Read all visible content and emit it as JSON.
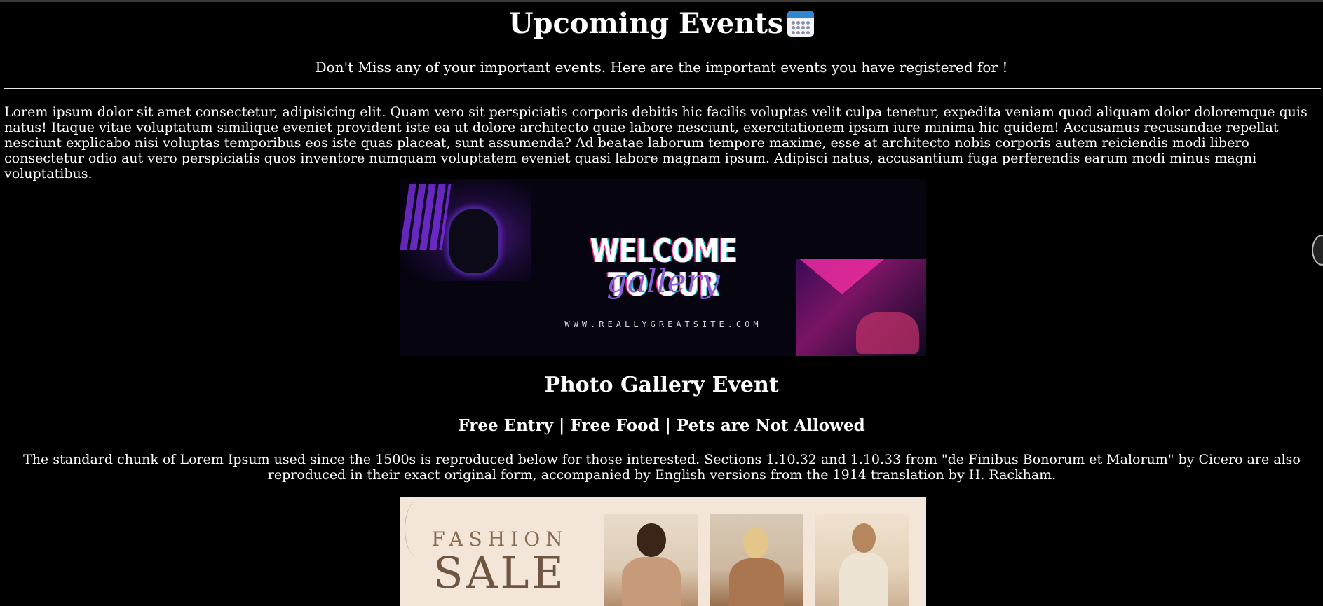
{
  "header": {
    "title": "Upcoming Events",
    "title_icon": "calendar-icon",
    "subtitle": "Don't Miss any of your important events. Here are the important events you have registered for !"
  },
  "intro": {
    "text": "Lorem ipsum dolor sit amet consectetur, adipisicing elit. Quam vero sit perspiciatis corporis debitis hic facilis voluptas velit culpa tenetur, expedita veniam quod aliquam dolor doloremque quis natus! Itaque vitae voluptatum similique eveniet provident iste ea ut dolore architecto quae labore nesciunt, exercitationem ipsam iure minima hic quidem! Accusamus recusandae repellat nesciunt explicabo nisi voluptas temporibus eos iste quas placeat, sunt assumenda? Ad beatae laborum tempore maxime, esse at architecto nobis corporis autem reiciendis modi libero consectetur odio aut vero perspiciatis quos inventore numquam voluptatem eveniet quasi labore magnam ipsum. Adipisci natus, accusantium fuga perferendis earum modi minus magni voluptatibus."
  },
  "gallery_banner": {
    "headline": "WELCOME TO OUR",
    "script": "gallery",
    "url": "WWW.REALLYGREATSITE.COM"
  },
  "event": {
    "title": "Photo Gallery Event",
    "meta": "Free Entry | Free Food | Pets are Not Allowed",
    "description": "The standard chunk of Lorem Ipsum used since the 1500s is reproduced below for those interested. Sections 1.10.32 and 1.10.33 from \"de Finibus Bonorum et Malorum\" by Cicero are also reproduced in their exact original form, accompanied by English versions from the 1914 translation by H. Rackham."
  },
  "fashion_banner": {
    "line1": "FASHION",
    "line2": "SALE"
  }
}
